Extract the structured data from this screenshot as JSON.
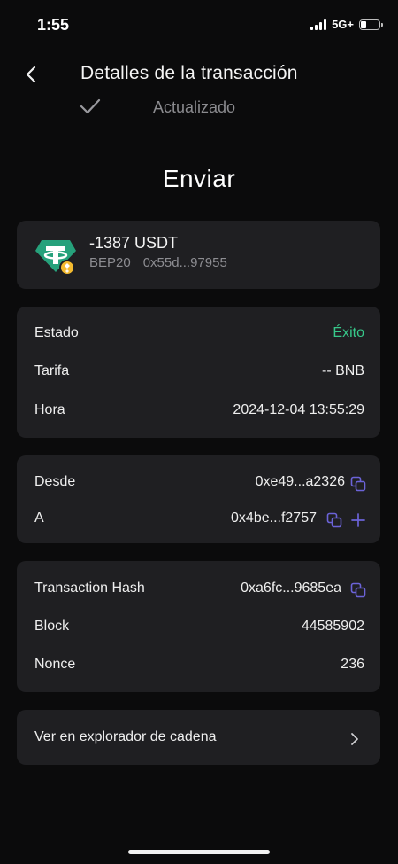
{
  "status_bar": {
    "time": "1:55",
    "network": "5G+"
  },
  "header": {
    "title": "Detalles de la transacción",
    "updated": "Actualizado"
  },
  "heading": "Enviar",
  "token": {
    "amount": "-1387 USDT",
    "network": "BEP20",
    "address": "0x55d...97955"
  },
  "details": {
    "estado": {
      "label": "Estado",
      "value": "Éxito"
    },
    "tarifa": {
      "label": "Tarifa",
      "value": "-- BNB"
    },
    "hora": {
      "label": "Hora",
      "value": "2024-12-04 13:55:29"
    }
  },
  "parties": {
    "desde": {
      "label": "Desde",
      "value": "0xe49...a2326"
    },
    "a": {
      "label": "A",
      "value": "0x4be...f2757"
    }
  },
  "chain": {
    "hash": {
      "label": "Transaction Hash",
      "value": "0xa6fc...9685ea"
    },
    "block": {
      "label": "Block",
      "value": "44585902"
    },
    "nonce": {
      "label": "Nonce",
      "value": "236"
    }
  },
  "explorer": {
    "label": "Ver en explorador de cadena"
  },
  "colors": {
    "success": "#37c88a",
    "accent": "#6b63d8",
    "card": "#1f1f22",
    "background": "#0b0b0c"
  },
  "icons": [
    "back-arrow-icon",
    "checkmark-icon",
    "tether-icon",
    "bnb-badge-icon",
    "copy-icon",
    "plus-icon",
    "chevron-right-icon"
  ]
}
